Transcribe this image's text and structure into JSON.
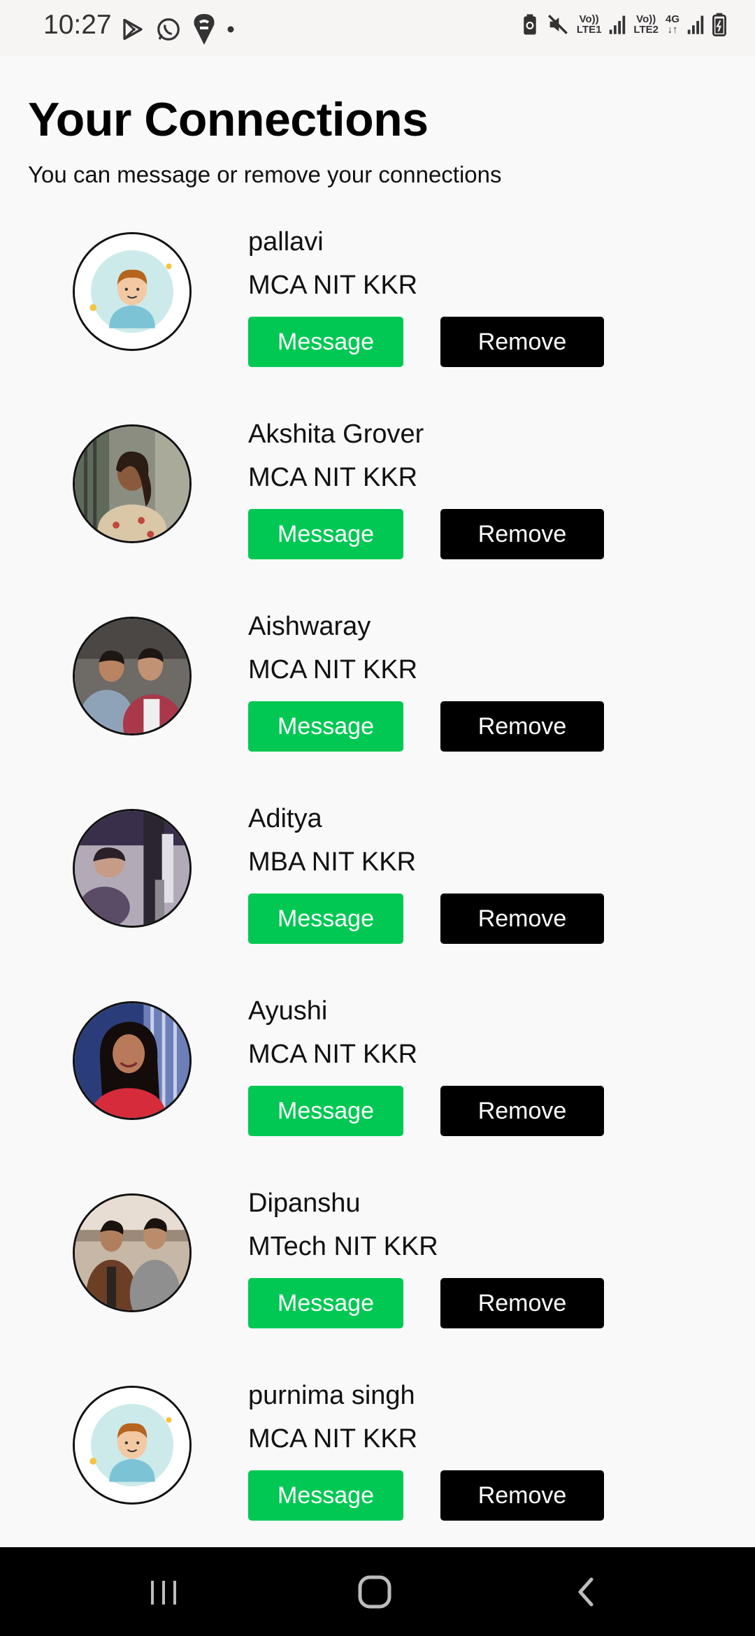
{
  "status_bar": {
    "time": "10:27",
    "sim1_label_top": "Vo))",
    "sim1_label_bottom": "LTE1",
    "sim2_label_top": "Vo))",
    "sim2_label_bottom": "LTE2",
    "net_type_top": "4G",
    "net_type_bottom": "↓↑"
  },
  "header": {
    "title": "Your Connections",
    "subtitle": "You can message or remove your connections"
  },
  "connections": [
    {
      "name": "pallavi",
      "detail": "MCA NIT KKR",
      "avatar": "default-avatar",
      "message_label": "Message",
      "remove_label": "Remove"
    },
    {
      "name": "Akshita Grover",
      "detail": "MCA NIT KKR",
      "avatar": "photo",
      "message_label": "Message",
      "remove_label": "Remove"
    },
    {
      "name": "Aishwaray",
      "detail": "MCA NIT KKR",
      "avatar": "photo",
      "message_label": "Message",
      "remove_label": "Remove"
    },
    {
      "name": "Aditya",
      "detail": "MBA NIT KKR",
      "avatar": "photo",
      "message_label": "Message",
      "remove_label": "Remove"
    },
    {
      "name": "Ayushi",
      "detail": "MCA NIT KKR",
      "avatar": "photo",
      "message_label": "Message",
      "remove_label": "Remove"
    },
    {
      "name": "Dipanshu",
      "detail": "MTech NIT KKR",
      "avatar": "photo",
      "message_label": "Message",
      "remove_label": "Remove"
    },
    {
      "name": "purnima singh",
      "detail": "MCA NIT KKR",
      "avatar": "default-avatar",
      "message_label": "Message",
      "remove_label": "Remove"
    }
  ],
  "colors": {
    "message_button": "#00c853",
    "remove_button": "#000000",
    "background": "#f9f9f9"
  },
  "nav_bar": {
    "recents_icon": "recents-icon",
    "home_icon": "home-icon",
    "back_icon": "back-icon"
  }
}
